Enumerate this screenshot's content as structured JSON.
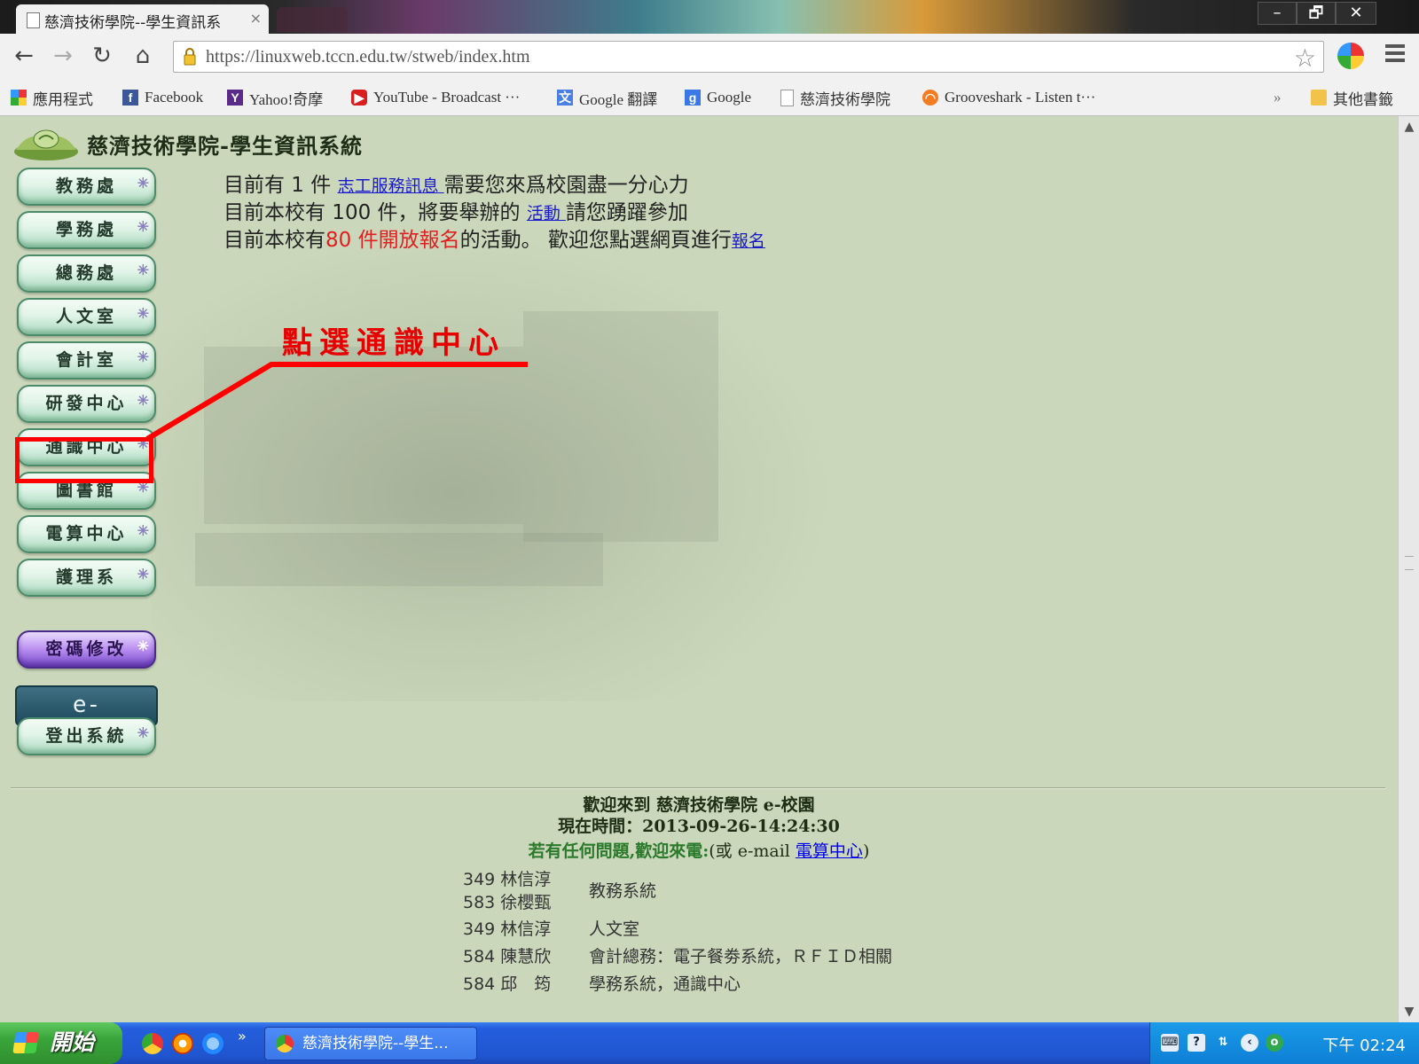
{
  "browser": {
    "tab_title": "慈濟技術學院--學生資訊系",
    "tab_close": "×",
    "url": "https://linuxweb.tccn.edu.tw/stweb/index.htm",
    "window_buttons": {
      "minimize": "–",
      "restore": "🗗",
      "close": "✕"
    },
    "nav": {
      "back": "←",
      "forward": "→",
      "reload": "↻",
      "home": "⌂",
      "star": "☆"
    },
    "bookmarks": [
      {
        "label": "應用程式",
        "icon": "apps-grid-icon"
      },
      {
        "label": "Facebook",
        "icon": "facebook-icon"
      },
      {
        "label": "Yahoo!奇摩",
        "icon": "yahoo-icon"
      },
      {
        "label": "YouTube - Broadcast ···",
        "icon": "youtube-icon"
      },
      {
        "label": "Google 翻譯",
        "icon": "google-translate-icon"
      },
      {
        "label": "Google",
        "icon": "google-icon"
      },
      {
        "label": "慈濟技術學院",
        "icon": "page-icon"
      },
      {
        "label": "Grooveshark - Listen t···",
        "icon": "grooveshark-icon"
      }
    ],
    "bookmarks_overflow": "»",
    "other_bookmarks": "其他書籤"
  },
  "page": {
    "site_title": "慈濟技術學院-學生資訊系統",
    "menu": [
      {
        "label": "教務處"
      },
      {
        "label": "學務處"
      },
      {
        "label": "總務處"
      },
      {
        "label": "人文室"
      },
      {
        "label": "會計室"
      },
      {
        "label": "研發中心"
      },
      {
        "label": "通識中心"
      },
      {
        "label": "圖書館"
      },
      {
        "label": "電算中心"
      },
      {
        "label": "護理系"
      }
    ],
    "password_button": "密碼修改",
    "eportfolio_button": "e-Portfolio",
    "logout_button": "登出系統",
    "notices": {
      "line1_prefix": "目前有 1 件 ",
      "line1_link": "志工服務訊息 ",
      "line1_suffix": "需要您來爲校園盡一分心力",
      "line2_prefix": "目前本校有 100 件，將要舉辦的 ",
      "line2_link": "活動 ",
      "line2_suffix": "請您踴躍參加",
      "line3_prefix": "目前本校有",
      "line3_red": "80 件開放報名",
      "line3_suffix": "的活動。 歡迎您點選網頁進行",
      "line3_link": "報名"
    },
    "annotation": "點選通識中心",
    "footer": {
      "welcome": "歡迎來到 慈濟技術學院 e-校園",
      "time": "現在時間：2013-09-26-14:24:30",
      "contact_prefix": "若有任何問題,歡迎來電:",
      "contact_mid": "(或 e-mail ",
      "contact_link": "電算中心",
      "contact_end": ")"
    },
    "contacts": [
      {
        "ext": "349 林信淳",
        "ext2": "583 徐櫻甄",
        "desc": "教務系統"
      },
      {
        "ext": "349 林信淳",
        "desc": "人文室"
      },
      {
        "ext": "584 陳慧欣",
        "desc": "會計總務：電子餐劵系統，ＲＦＩＤ相關"
      },
      {
        "ext": "584 邱　筠",
        "desc": "學務系統，通識中心"
      }
    ]
  },
  "taskbar": {
    "start": "開始",
    "quick_launch_more": "»",
    "task_title": "慈濟技術學院--學生...",
    "clock": "下午 02:24"
  }
}
